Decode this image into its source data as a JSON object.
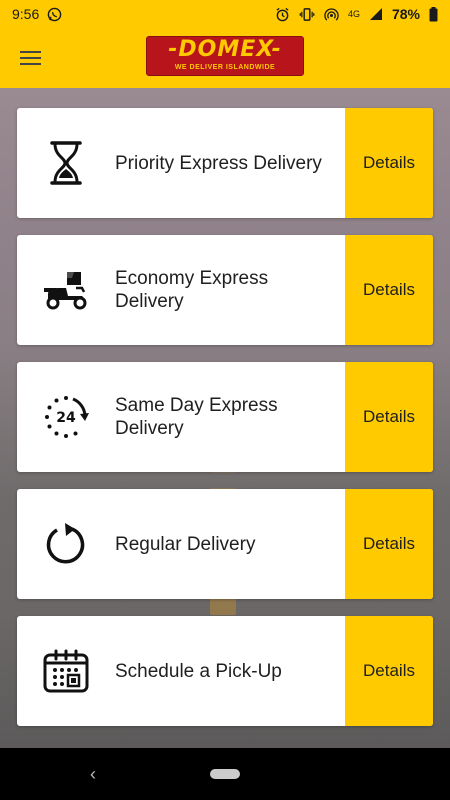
{
  "status_bar": {
    "time": "9:56",
    "network": "4G",
    "battery": "78%",
    "icons": [
      "whatsapp-icon",
      "alarm-icon",
      "vibrate-icon",
      "hotspot-icon",
      "signal-icon",
      "battery-icon"
    ]
  },
  "header": {
    "menu_icon": "hamburger-menu-icon",
    "logo_text": "-DOMEX-",
    "logo_tagline": "WE DELIVER ISLANDWIDE"
  },
  "services": [
    {
      "title": "Priority Express Delivery",
      "details_label": "Details",
      "icon": "hourglass-icon"
    },
    {
      "title": "Economy Express Delivery",
      "details_label": "Details",
      "icon": "delivery-scooter-icon"
    },
    {
      "title": "Same Day Express Delivery",
      "details_label": "Details",
      "icon": "24-hour-icon"
    },
    {
      "title": "Regular Delivery",
      "details_label": "Details",
      "icon": "refresh-icon"
    },
    {
      "title": "Schedule a Pick-Up",
      "details_label": "Details",
      "icon": "calendar-icon"
    }
  ],
  "colors": {
    "brand_yellow": "#FFCA00",
    "brand_red": "#B8141C"
  }
}
